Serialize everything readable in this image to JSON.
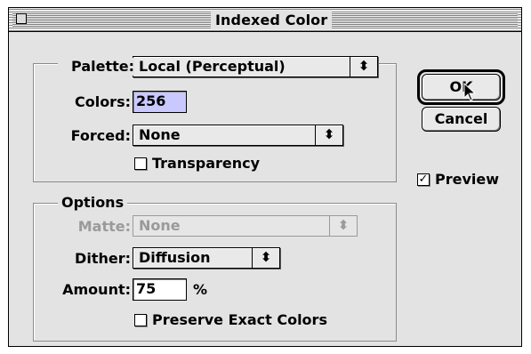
{
  "window": {
    "title": "Indexed Color"
  },
  "palette_group": {
    "palette_label": "Palette:",
    "palette_value": "Local (Perceptual)",
    "colors_label": "Colors:",
    "colors_value": "256",
    "forced_label": "Forced:",
    "forced_value": "None",
    "transparency_label": "Transparency",
    "transparency_checked": false
  },
  "options_group": {
    "title": "Options",
    "matte_label": "Matte:",
    "matte_value": "None",
    "dither_label": "Dither:",
    "dither_value": "Diffusion",
    "amount_label": "Amount:",
    "amount_value": "75",
    "amount_unit": "%",
    "preserve_label": "Preserve Exact Colors",
    "preserve_checked": false
  },
  "buttons": {
    "ok_label": "OK",
    "cancel_label": "Cancel"
  },
  "preview": {
    "label": "Preview",
    "checked": true,
    "check_glyph": "✓"
  },
  "icons": {
    "popup_arrows": "⬍",
    "cursor": "arrow-cursor-icon"
  },
  "colors": {
    "selection": "#c9c9ff",
    "dialog_bg": "#e3e3e3"
  }
}
